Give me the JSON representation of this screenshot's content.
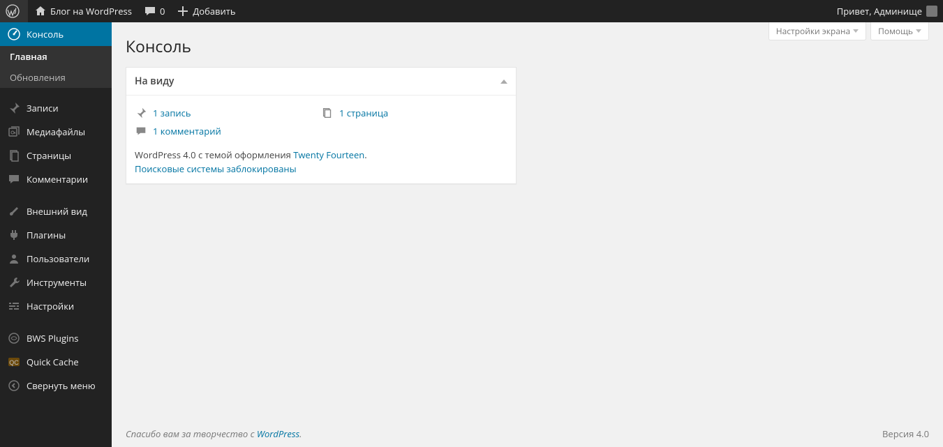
{
  "adminbar": {
    "site_name": "Блог на WordPress",
    "comments_count": "0",
    "add_new": "Добавить",
    "greeting": "Привет, Админище"
  },
  "sidebar": {
    "items": [
      {
        "label": "Консоль",
        "current": true
      },
      {
        "label": "Записи"
      },
      {
        "label": "Медиафайлы"
      },
      {
        "label": "Страницы"
      },
      {
        "label": "Комментарии"
      },
      {
        "label": "Внешний вид"
      },
      {
        "label": "Плагины"
      },
      {
        "label": "Пользователи"
      },
      {
        "label": "Инструменты"
      },
      {
        "label": "Настройки"
      },
      {
        "label": "BWS Plugins"
      },
      {
        "label": "Quick Cache"
      },
      {
        "label": "Свернуть меню"
      }
    ],
    "submenu": [
      {
        "label": "Главная",
        "current": true
      },
      {
        "label": "Обновления"
      }
    ]
  },
  "header": {
    "screen_options": "Настройки экрана",
    "help": "Помощь"
  },
  "page": {
    "title": "Консоль"
  },
  "glance": {
    "title": "На виду",
    "posts": "1 запись",
    "pages": "1 страница",
    "comments": "1 комментарий",
    "theme_prefix": "WordPress 4.0 с темой оформления ",
    "theme_name": "Twenty Fourteen",
    "theme_suffix": ".",
    "search_blocked": "Поисковые системы заблокированы"
  },
  "footer": {
    "thanks_prefix": "Спасибо вам за творчество с ",
    "wp": "WordPress",
    "thanks_suffix": ".",
    "version": "Версия 4.0"
  }
}
